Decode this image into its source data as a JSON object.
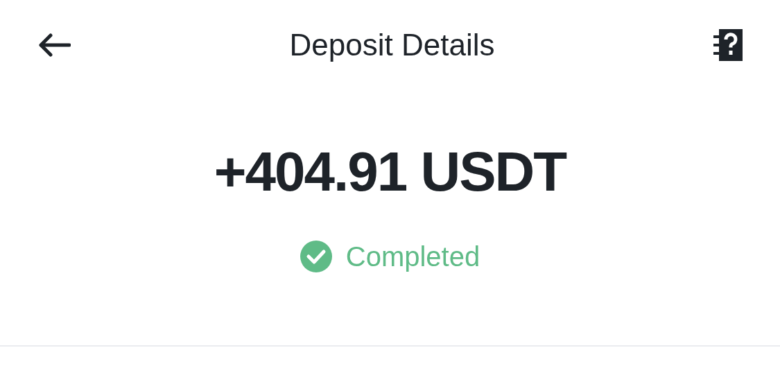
{
  "header": {
    "title": "Deposit Details"
  },
  "amount": "+404.91 USDT",
  "status": {
    "label": "Completed",
    "kind": "completed"
  }
}
